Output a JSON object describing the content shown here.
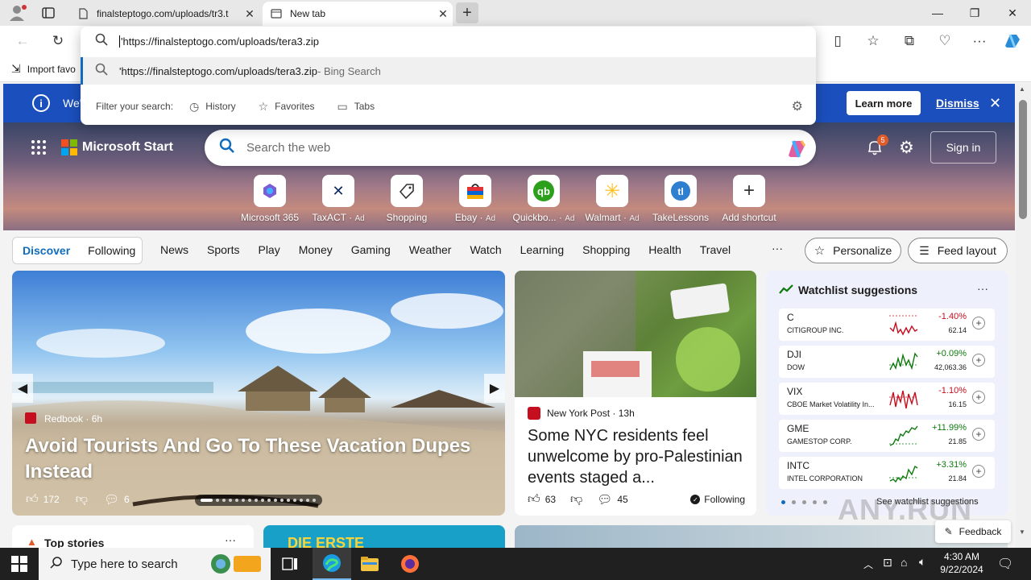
{
  "browser": {
    "tabs": [
      {
        "label": "finalsteptogo.com/uploads/tr3.t",
        "active": false
      },
      {
        "label": "New tab",
        "active": true
      }
    ],
    "address_value": "'https://finalsteptogo.com/uploads/tera3.zip",
    "suggestion": {
      "text": "'https://finalsteptogo.com/uploads/tera3.zip",
      "suffix": " - Bing Search"
    },
    "filter_label": "Filter your search:",
    "filters": [
      "History",
      "Favorites",
      "Tabs"
    ],
    "bookmark": "Import favo"
  },
  "infobar": {
    "text": "We'",
    "learn_more": "Learn more",
    "dismiss": "Dismiss"
  },
  "start": {
    "brand": "Microsoft Start",
    "search_placeholder": "Search the web",
    "notification_count": "5",
    "sign_in": "Sign in",
    "tiles": [
      {
        "label": "Microsoft 365",
        "ad": ""
      },
      {
        "label": "TaxACT",
        "ad": "Ad"
      },
      {
        "label": "Shopping",
        "ad": ""
      },
      {
        "label": "Ebay",
        "ad": "Ad"
      },
      {
        "label": "Quickbo...",
        "ad": "Ad"
      },
      {
        "label": "Walmart",
        "ad": "Ad"
      },
      {
        "label": "TakeLessons",
        "ad": ""
      },
      {
        "label": "Add shortcut",
        "ad": ""
      }
    ],
    "feed_tabs": {
      "active": "Discover",
      "other": "Following"
    },
    "nav": [
      "News",
      "Sports",
      "Play",
      "Money",
      "Gaming",
      "Weather",
      "Watch",
      "Learning",
      "Shopping",
      "Health",
      "Travel"
    ],
    "more": "···",
    "personalize": "Personalize",
    "feed_layout": "Feed layout"
  },
  "main_card": {
    "source": "Redbook",
    "age": "6h",
    "title": "Avoid Tourists And Go To These Vacation Dupes Instead",
    "likes": "172",
    "comments": "6"
  },
  "mid_card": {
    "source": "New York Post",
    "age": "13h",
    "title": "Some NYC residents feel unwelcome by pro-Palestinian events staged a...",
    "likes": "63",
    "comments": "45",
    "following": "Following"
  },
  "watchlist": {
    "title": "Watchlist suggestions",
    "see_more": "See watchlist suggestions",
    "stocks": [
      {
        "symbol": "C",
        "name": "CITIGROUP INC.",
        "change": "-1.40%",
        "price": "62.14",
        "up": false
      },
      {
        "symbol": "DJI",
        "name": "DOW",
        "change": "+0.09%",
        "price": "42,063.36",
        "up": true
      },
      {
        "symbol": "VIX",
        "name": "CBOE Market Volatility In...",
        "change": "-1.10%",
        "price": "16.15",
        "up": false
      },
      {
        "symbol": "GME",
        "name": "GAMESTOP CORP.",
        "change": "+11.99%",
        "price": "21.85",
        "up": true
      },
      {
        "symbol": "INTC",
        "name": "INTEL CORPORATION",
        "change": "+3.31%",
        "price": "21.84",
        "up": true
      }
    ],
    "colors": {
      "up": "#0e7a0d",
      "down": "#c50f1f"
    }
  },
  "bottom": {
    "top_stories": "Top stories",
    "promo": "DIE ERSTE",
    "feedback": "Feedback"
  },
  "watermark": "ANY.RUN",
  "taskbar": {
    "search_placeholder": "Type here to search",
    "time": "4:30 AM",
    "date": "9/22/2024"
  }
}
